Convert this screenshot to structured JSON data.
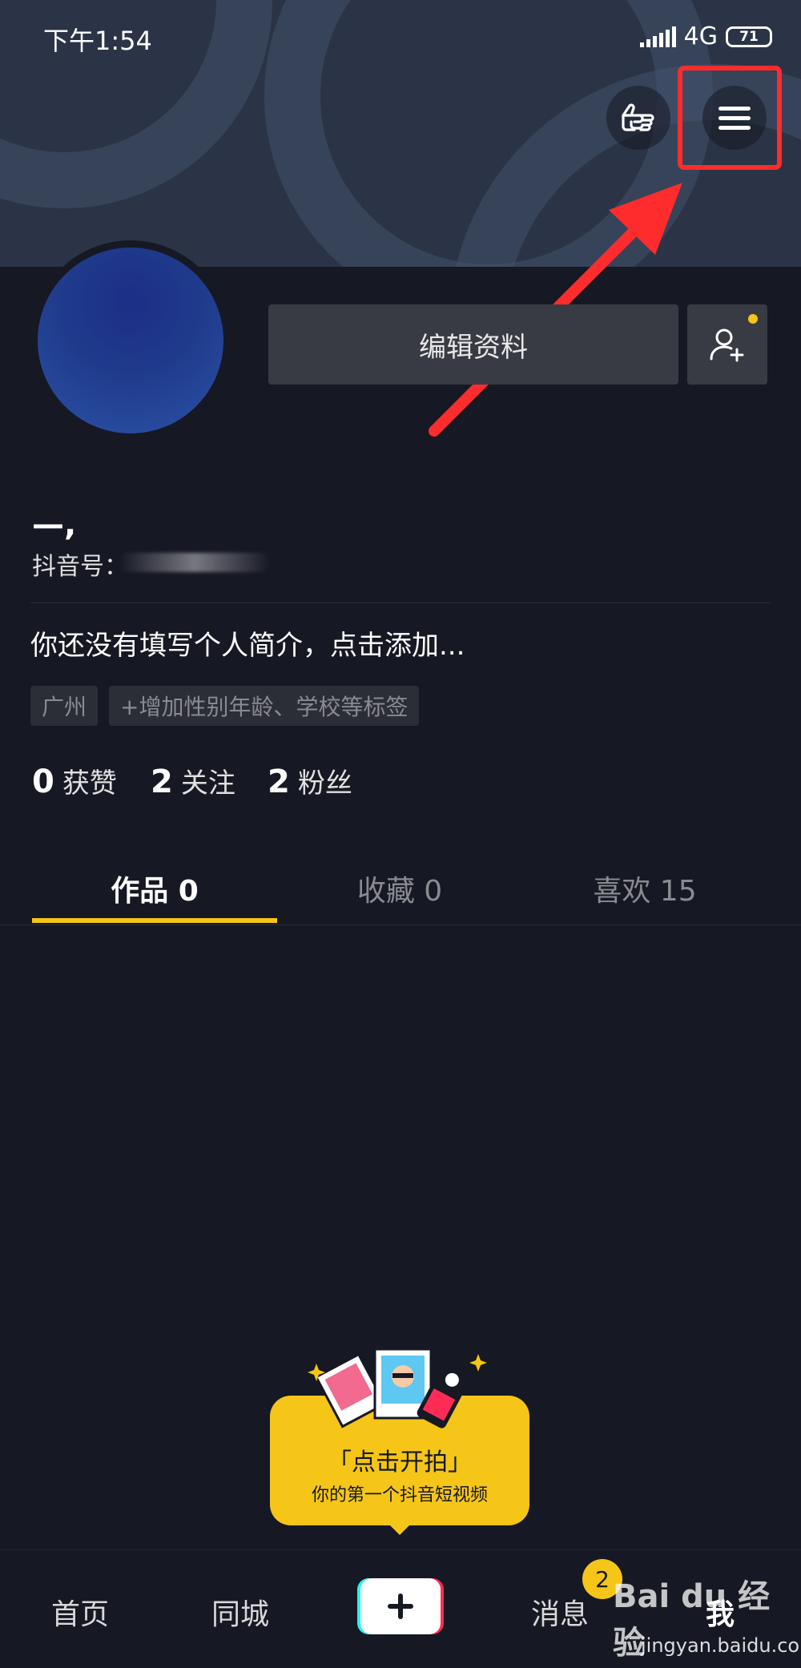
{
  "status_bar": {
    "time": "下午1:54",
    "network": "4G",
    "battery": "71"
  },
  "profile": {
    "nickname": "—,",
    "douyin_id_label": "抖音号：",
    "edit_button_label": "编辑资料",
    "bio": "你还没有填写个人简介，点击添加...",
    "tags": [
      "广州",
      "+增加性别年龄、学校等标签"
    ],
    "stats": [
      {
        "value": "0",
        "label": "获赞"
      },
      {
        "value": "2",
        "label": "关注"
      },
      {
        "value": "2",
        "label": "粉丝"
      }
    ]
  },
  "tabs": [
    {
      "label": "作品 0",
      "active": true
    },
    {
      "label": "收藏 0",
      "active": false
    },
    {
      "label": "喜欢 15",
      "active": false
    }
  ],
  "shoot_prompt": {
    "title": "「点击开拍」",
    "subtitle": "你的第一个抖音短视频"
  },
  "bottom_nav": {
    "items": [
      "首页",
      "同城",
      "消息",
      "我"
    ],
    "message_badge": "2"
  },
  "watermark": {
    "brand": "Bai du 经验",
    "url": "jingyan.baidu.com"
  },
  "colors": {
    "accent": "#f5c517",
    "annotation": "#fe2c2c",
    "background": "#161823"
  }
}
